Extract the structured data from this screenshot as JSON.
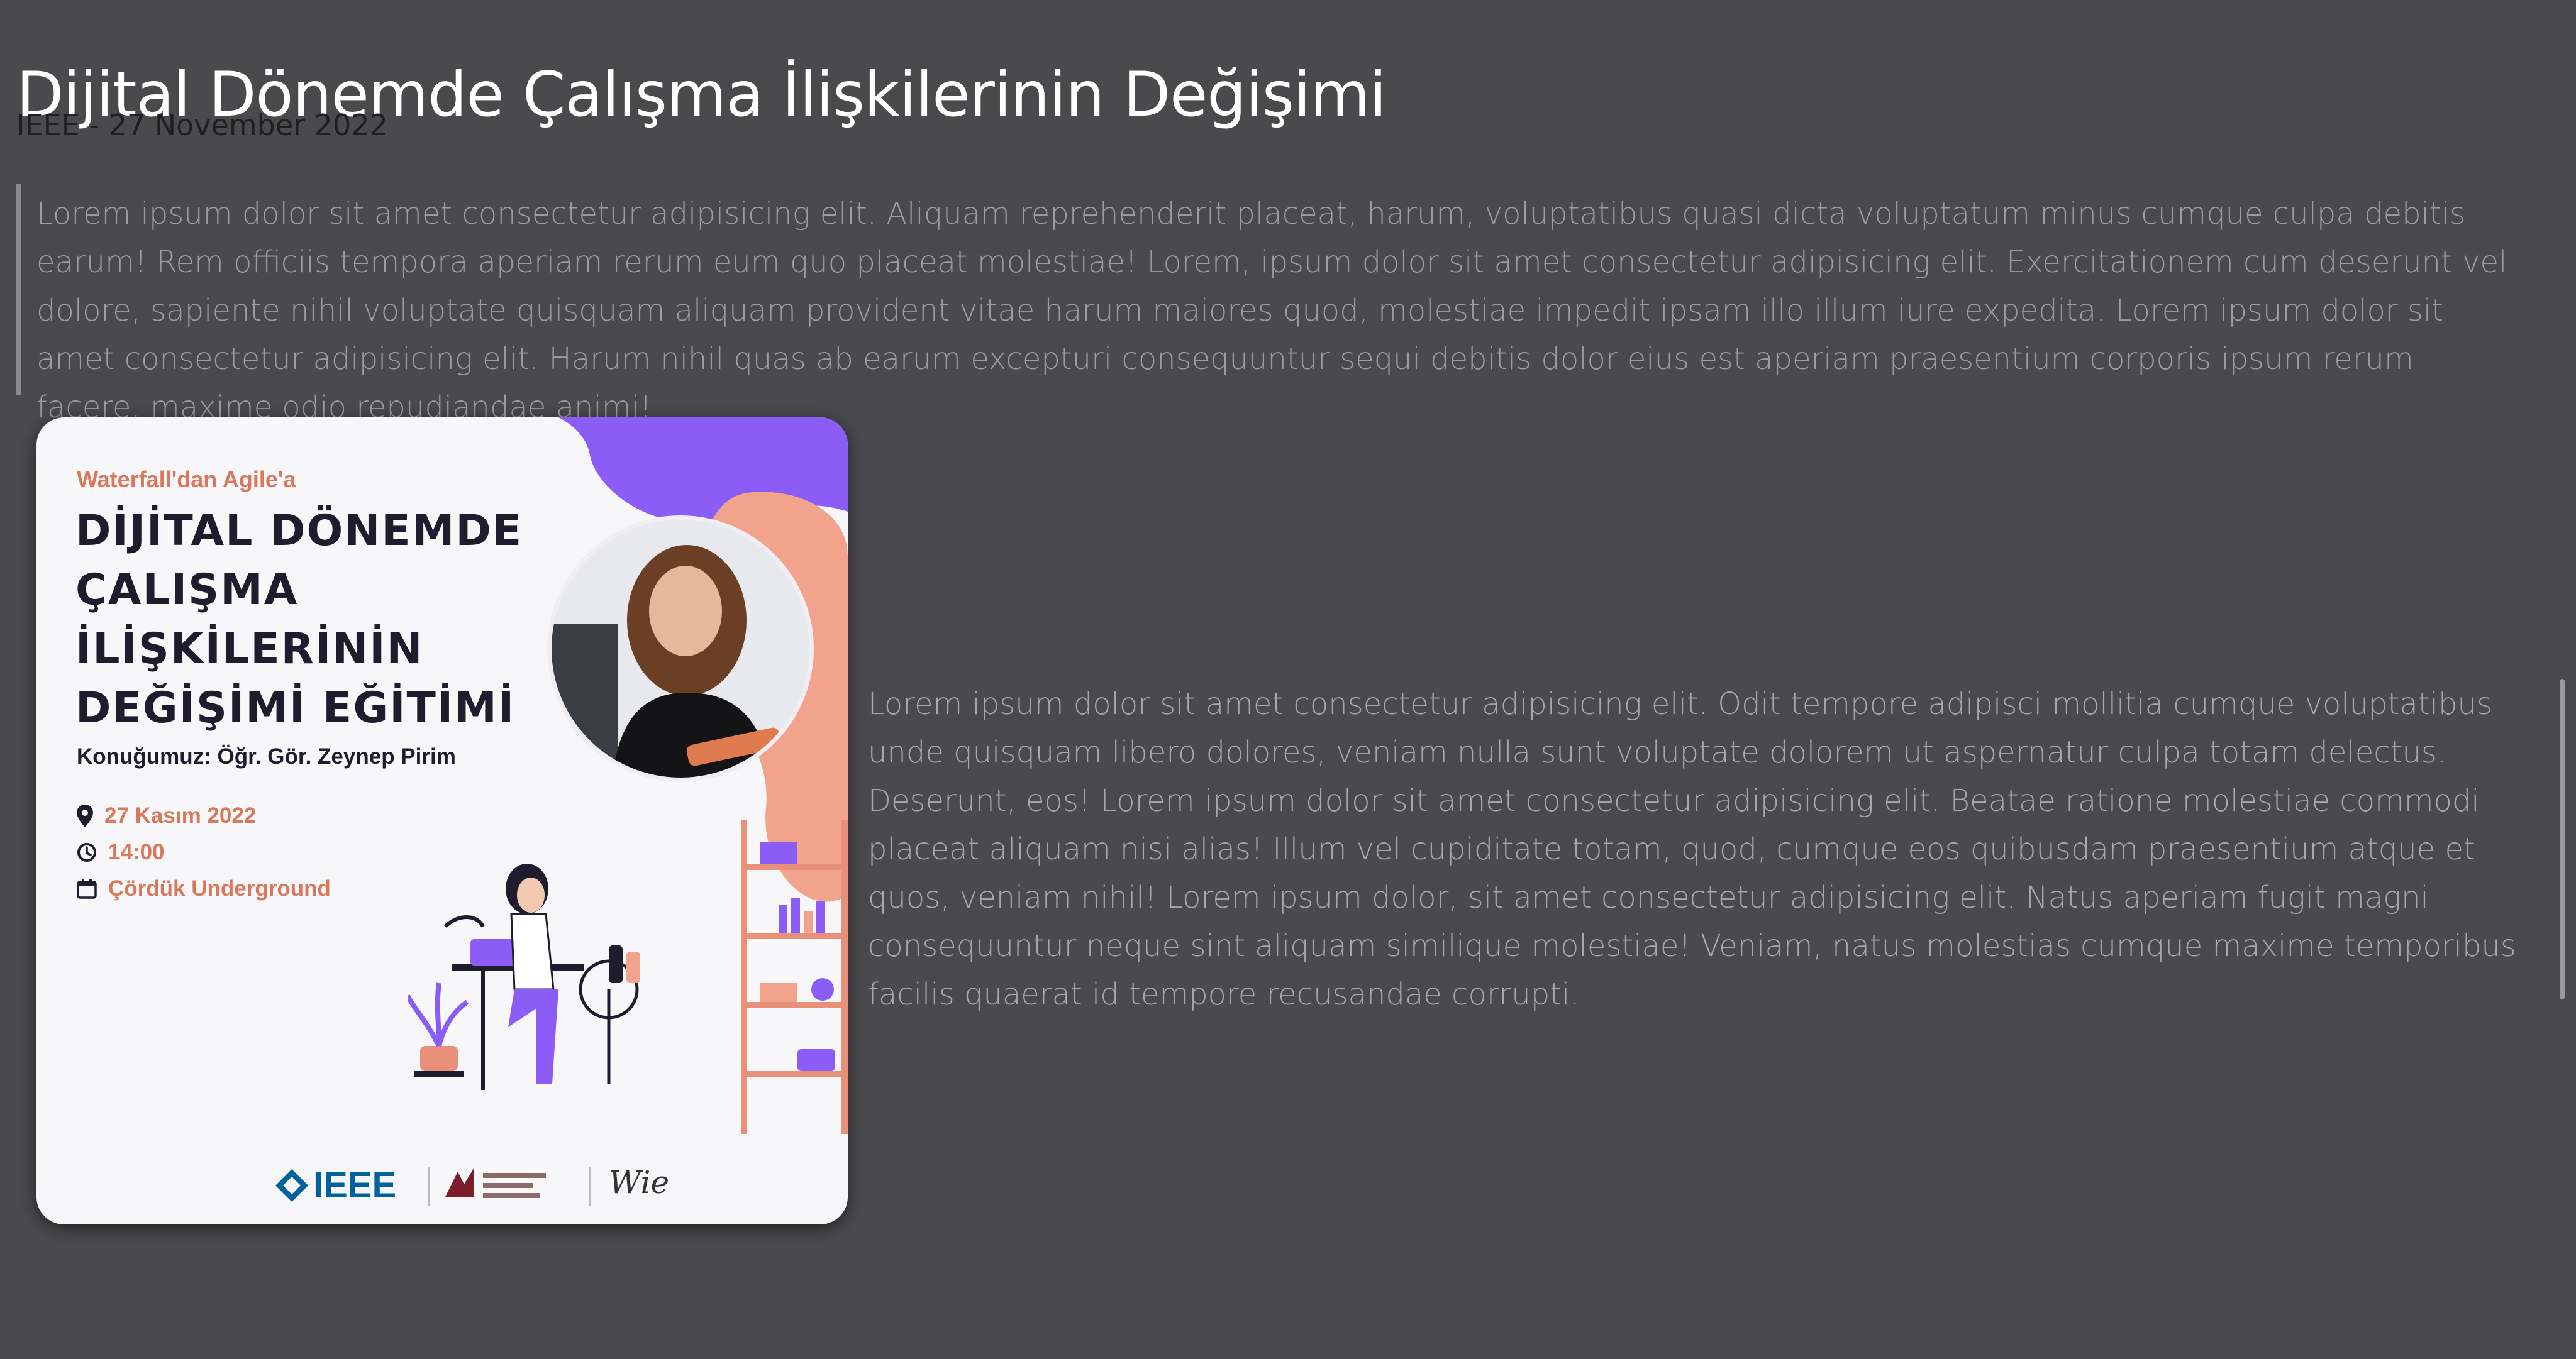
{
  "page": {
    "title": "Dijital Dönemde Çalışma İlişkilerinin Değişimi",
    "meta": "IEEE - 27 November 2022"
  },
  "quote": {
    "text": "Lorem ipsum dolor sit amet consectetur adipisicing elit. Aliquam reprehenderit placeat, harum, voluptatibus quasi dicta voluptatum minus cumque culpa debitis earum! Rem officiis tempora aperiam rerum eum quo placeat molestiae! Lorem, ipsum dolor sit amet consectetur adipisicing elit. Exercitationem cum deserunt vel dolore, sapiente nihil voluptate quisquam aliquam provident vitae harum maiores quod, molestiae impedit ipsam illo illum iure expedita. Lorem ipsum dolor sit amet consectetur adipisicing elit. Harum nihil quas ab earum excepturi consequuntur sequi debitis dolor eius est aperiam praesentium corporis ipsum rerum facere, maxime odio repudiandae animi!"
  },
  "poster": {
    "kicker": "Waterfall'dan Agile'a",
    "headline": "DİJİTAL DÖNEMDE ÇALIŞMA İLİŞKİLERİNİN DEĞİŞİMİ EĞİTİMİ",
    "speaker": "Konuğumuz: Öğr. Gör. Zeynep Pirim",
    "date": "27 Kasım 2022",
    "time": "14:00",
    "venue": "Çördük Underground",
    "logo_ieee": "IEEE",
    "logo_wie": "Wie",
    "colors": {
      "accent": "#d9785c",
      "purple": "#8b5cf6",
      "ink": "#1f1c2e",
      "ieee": "#00629b"
    }
  },
  "body": {
    "text": "Lorem ipsum dolor sit amet consectetur adipisicing elit. Odit tempore adipisci mollitia cumque voluptatibus unde quisquam libero dolores, veniam nulla sunt voluptate dolorem ut aspernatur culpa totam delectus. Deserunt, eos! Lorem ipsum dolor sit amet consectetur adipisicing elit. Beatae ratione molestiae commodi placeat aliquam nisi alias! Illum vel cupiditate totam, quod, cumque eos quibusdam praesentium atque et quos, veniam nihil! Lorem ipsum dolor, sit amet consectetur adipisicing elit. Natus aperiam fugit magni consequuntur neque sint aliquam similique molestiae! Veniam, natus molestias cumque maxime temporibus facilis quaerat id tempore recusandae corrupti."
  }
}
